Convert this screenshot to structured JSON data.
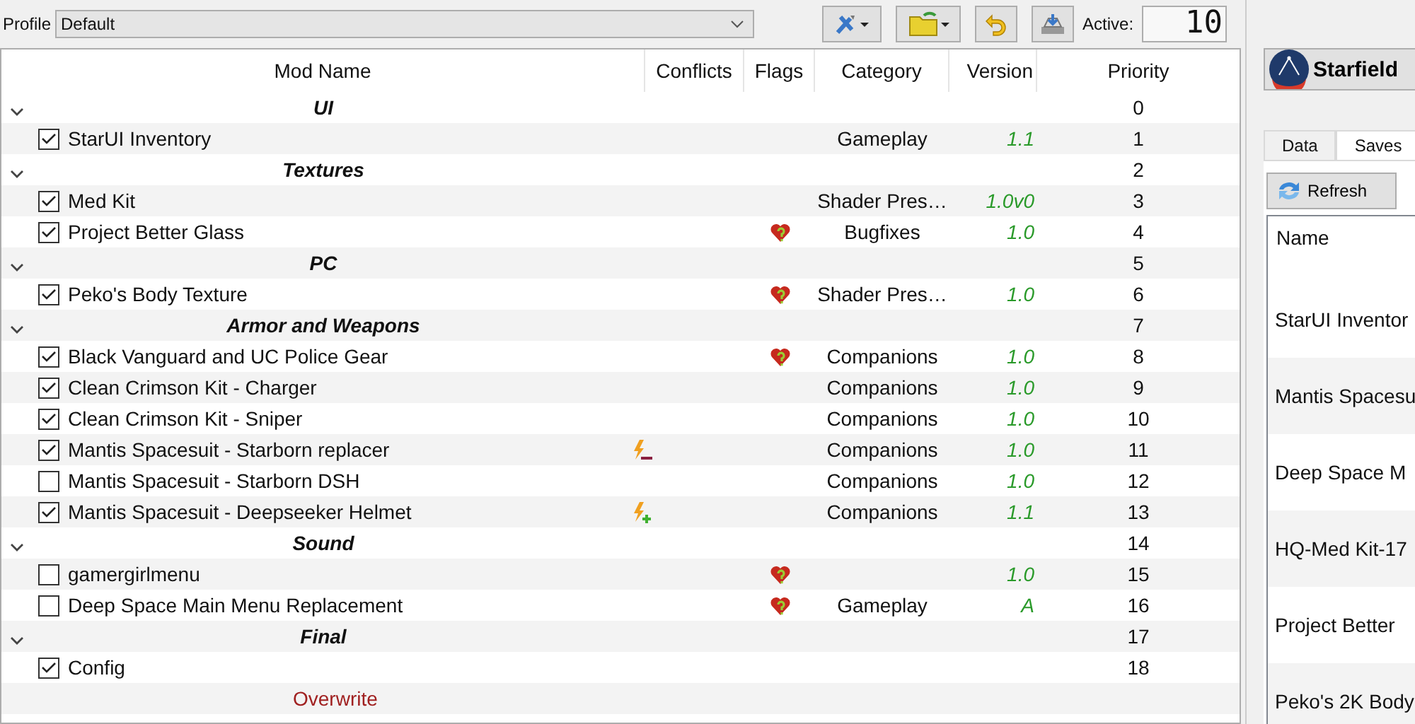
{
  "toolbar": {
    "profile_label": "Profile",
    "profile_value": "Default",
    "active_label": "Active:",
    "active_count": "10"
  },
  "table": {
    "columns": [
      "Mod Name",
      "Conflicts",
      "Flags",
      "Category",
      "Version",
      "Priority"
    ],
    "rows": [
      {
        "kind": "separator",
        "name": "UI",
        "expanded": true,
        "priority": "0"
      },
      {
        "kind": "mod",
        "checked": true,
        "name": "StarUI Inventory",
        "warning": false,
        "overwrites": false,
        "overwritten": false,
        "category": "Gameplay",
        "version": "1.1",
        "priority": "1"
      },
      {
        "kind": "separator",
        "name": "Textures",
        "expanded": true,
        "priority": "2"
      },
      {
        "kind": "mod",
        "checked": true,
        "name": "Med Kit",
        "warning": false,
        "overwrites": false,
        "overwritten": false,
        "category": "Shader Pres…",
        "version": "1.0v0",
        "priority": "3"
      },
      {
        "kind": "mod",
        "checked": true,
        "name": "Project Better Glass",
        "warning": true,
        "overwrites": false,
        "overwritten": false,
        "category": "Bugfixes",
        "version": "1.0",
        "priority": "4"
      },
      {
        "kind": "separator",
        "name": "PC",
        "expanded": true,
        "priority": "5"
      },
      {
        "kind": "mod",
        "checked": true,
        "name": "Peko's Body Texture",
        "warning": true,
        "overwrites": false,
        "overwritten": false,
        "category": "Shader Pres…",
        "version": "1.0",
        "priority": "6"
      },
      {
        "kind": "separator",
        "name": "Armor and Weapons",
        "expanded": true,
        "priority": "7"
      },
      {
        "kind": "mod",
        "checked": true,
        "name": "Black Vanguard and UC Police Gear",
        "warning": true,
        "overwrites": false,
        "overwritten": false,
        "category": "Companions",
        "version": "1.0",
        "priority": "8"
      },
      {
        "kind": "mod",
        "checked": true,
        "name": "Clean Crimson Kit - Charger",
        "warning": false,
        "overwrites": false,
        "overwritten": false,
        "category": "Companions",
        "version": "1.0",
        "priority": "9"
      },
      {
        "kind": "mod",
        "checked": true,
        "name": "Clean Crimson Kit - Sniper",
        "warning": false,
        "overwrites": false,
        "overwritten": false,
        "category": "Companions",
        "version": "1.0",
        "priority": "10"
      },
      {
        "kind": "mod",
        "checked": true,
        "name": "Mantis Spacesuit - Starborn replacer",
        "warning": false,
        "overwrites": false,
        "overwritten": true,
        "category": "Companions",
        "version": "1.0",
        "priority": "11"
      },
      {
        "kind": "mod",
        "checked": false,
        "name": "Mantis Spacesuit - Starborn DSH",
        "warning": false,
        "overwrites": false,
        "overwritten": false,
        "category": "Companions",
        "version": "1.0",
        "priority": "12"
      },
      {
        "kind": "mod",
        "checked": true,
        "name": "Mantis Spacesuit - Deepseeker Helmet",
        "warning": false,
        "overwrites": true,
        "overwritten": false,
        "category": "Companions",
        "version": "1.1",
        "priority": "13"
      },
      {
        "kind": "separator",
        "name": "Sound",
        "expanded": true,
        "priority": "14"
      },
      {
        "kind": "mod",
        "checked": false,
        "name": "gamergirlmenu",
        "warning": true,
        "overwrites": false,
        "overwritten": false,
        "version": "1.0",
        "priority": "15"
      },
      {
        "kind": "mod",
        "checked": false,
        "name": "Deep Space Main Menu Replacement",
        "warning": true,
        "overwrites": false,
        "overwritten": false,
        "category": "Gameplay",
        "version": "A",
        "priority": "16"
      },
      {
        "kind": "separator",
        "name": "Final",
        "expanded": true,
        "priority": "17"
      },
      {
        "kind": "mod",
        "checked": true,
        "name": "Config",
        "warning": false,
        "overwrites": false,
        "overwritten": false,
        "priority": "18"
      },
      {
        "kind": "overwrite",
        "name": "Overwrite"
      }
    ]
  },
  "side": {
    "game": "Starfield",
    "tabs": [
      {
        "label": "Data",
        "selected": false
      },
      {
        "label": "Saves",
        "selected": true
      }
    ],
    "refresh": "Refresh",
    "list_header": "Name",
    "items": [
      "StarUI Inventor",
      "Mantis Spacesu",
      "Deep Space M",
      "HQ-Med Kit-17",
      "Project Better",
      "Peko's 2K Body"
    ]
  }
}
